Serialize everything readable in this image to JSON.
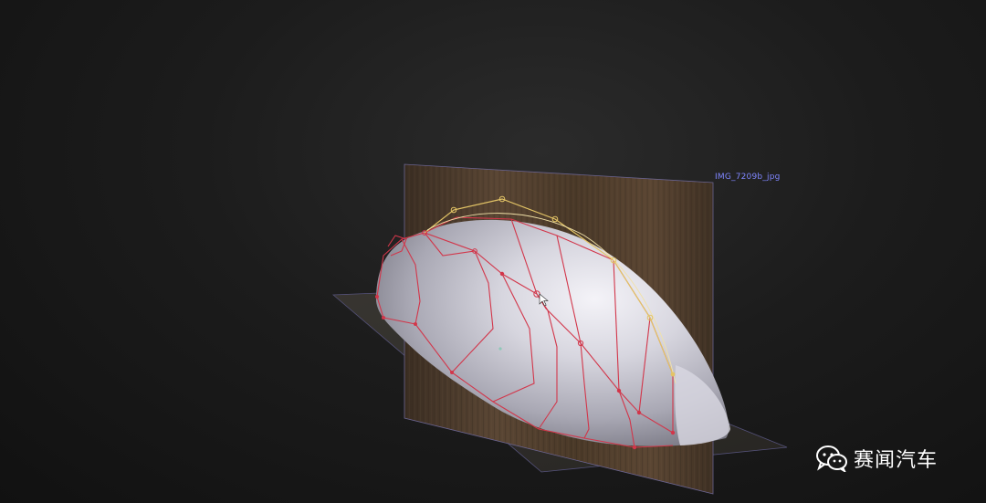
{
  "viewport": {
    "reference_image_label": "IMG_7209b_jpg"
  },
  "watermark": {
    "text": "赛闻汽车",
    "icon": "wechat-icon"
  },
  "colors": {
    "background": "#1c1c1c",
    "wood_panel": "#4b3a2b",
    "surface": "#c9c8d3",
    "red_curves": "#d2364a",
    "yellow_curve": "#e3c466",
    "label_blue": "#7f86ff"
  }
}
